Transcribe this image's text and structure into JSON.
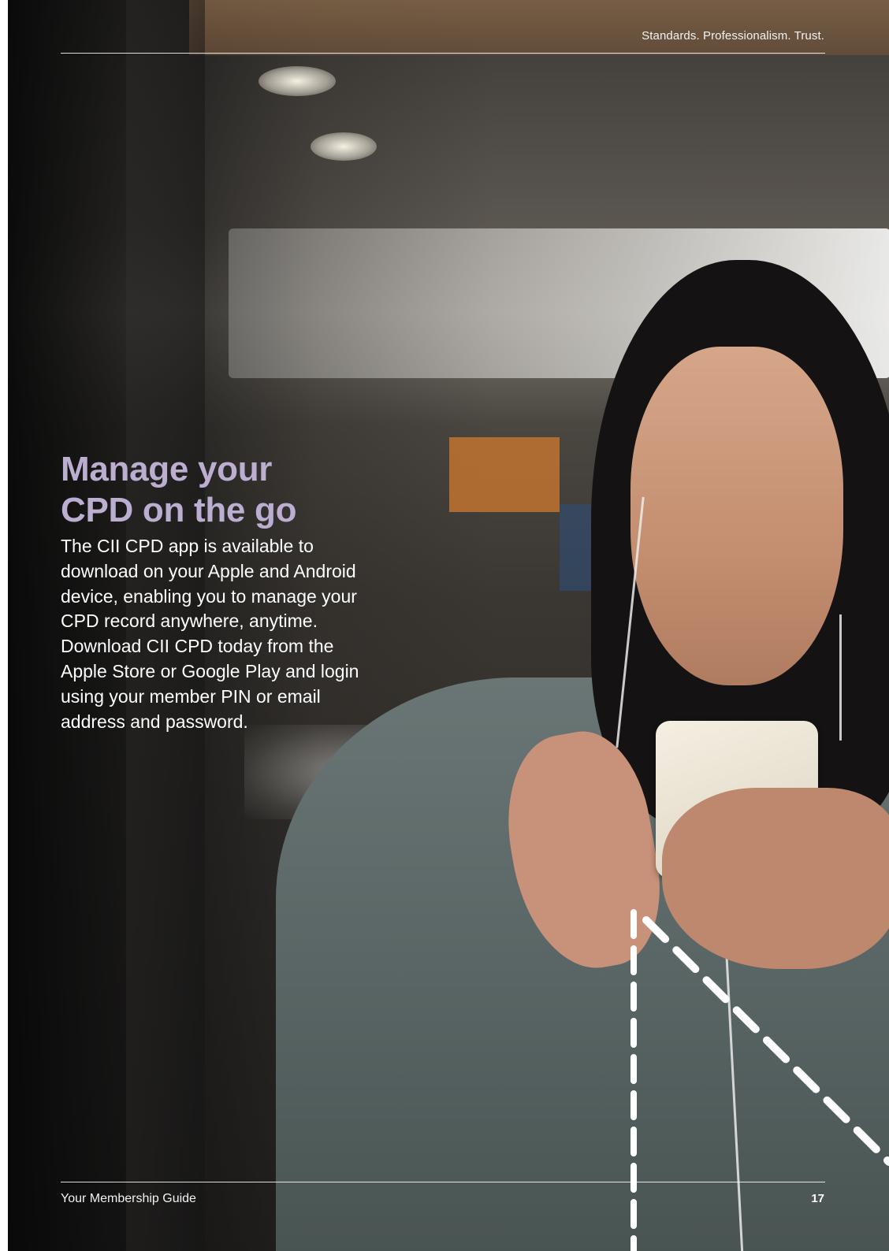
{
  "header": {
    "tagline": "Standards. Professionalism. Trust."
  },
  "main": {
    "heading_line1": "Manage your",
    "heading_line2": "CPD on the go",
    "body": "The CII CPD app is available to download on your Apple and Android device, enabling you to manage your CPD record anywhere, anytime. Download CII CPD today from the Apple Store or Google Play and login using your member PIN or email address and password."
  },
  "footer": {
    "title": "Your Membership Guide",
    "page_number": "17"
  },
  "colors": {
    "heading": "#bcaed0",
    "body_text": "#ffffff",
    "rule": "#ffffff"
  }
}
